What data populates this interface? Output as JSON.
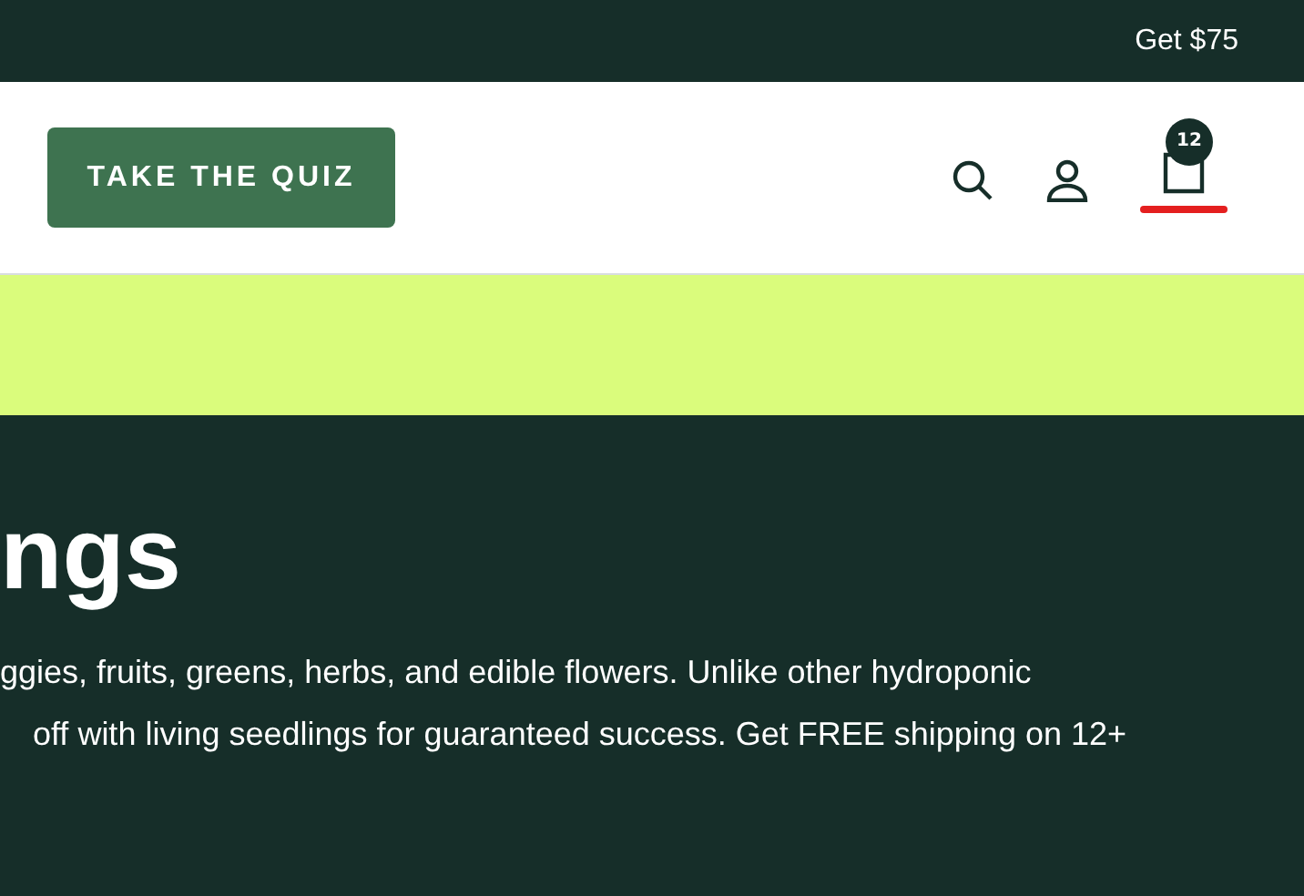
{
  "top_bar": {
    "text": "Get $75"
  },
  "header": {
    "quiz_button": "TAKE THE QUIZ",
    "cart_count": "12",
    "cart_selected": true
  },
  "hero": {
    "heading": "ngs",
    "lines": [
      "ggies, fruits, greens, herbs, and edible flowers. Unlike other hydroponic",
      "off with living seedlings for guaranteed success. Get FREE shipping on 12+"
    ]
  }
}
